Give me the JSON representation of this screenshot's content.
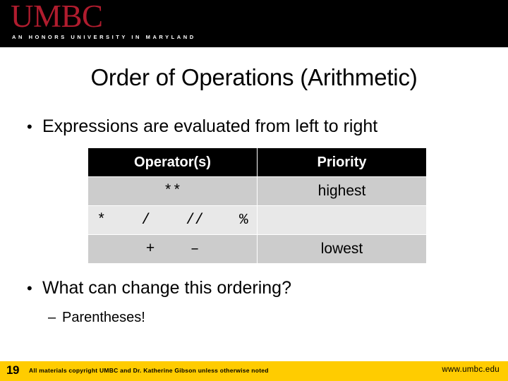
{
  "banner": {
    "logo_wordmark": "UMBC",
    "logo_tagline": "AN HONORS UNIVERSITY IN MARYLAND",
    "logo_color": "#b01c2e",
    "background_color": "#000000"
  },
  "slide": {
    "title": "Order of Operations (Arithmetic)",
    "bullets": [
      {
        "marker": "•",
        "text": "Expressions are evaluated from left to right"
      },
      {
        "marker": "•",
        "text": "What can change this ordering?"
      }
    ],
    "sub_bullet": {
      "marker": "–",
      "text": "Parentheses!"
    }
  },
  "table": {
    "headers": [
      "Operator(s)",
      "Priority"
    ],
    "rows": [
      {
        "operators": "**",
        "priority": "highest"
      },
      {
        "operators": "*    /    //    %",
        "priority": ""
      },
      {
        "operators": "+    –",
        "priority": "lowest"
      }
    ],
    "header_bg": "#000000",
    "header_fg": "#ffffff",
    "row_dark_bg": "#cccccc",
    "row_light_bg": "#e8e8e8"
  },
  "footer": {
    "slide_number": "19",
    "copyright": "All materials copyright UMBC and Dr. Katherine Gibson unless otherwise noted",
    "url": "www.umbc.edu",
    "background_color": "#ffcc00"
  }
}
